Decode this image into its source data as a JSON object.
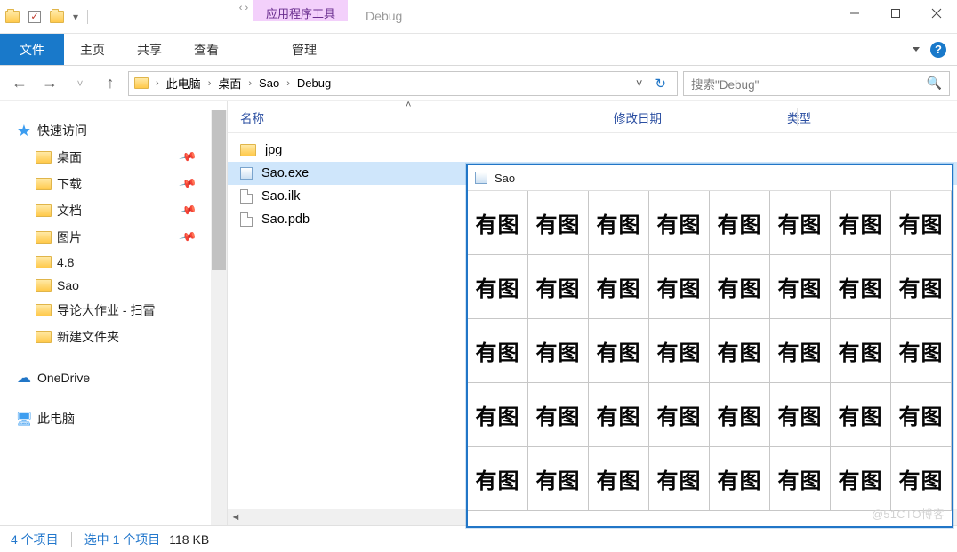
{
  "titlebar": {
    "tool_tab": "应用程序工具",
    "title": "Debug"
  },
  "ribbon": {
    "file": "文件",
    "tabs": [
      "主页",
      "共享",
      "查看"
    ],
    "tool_tab": "管理"
  },
  "address": {
    "segments": [
      "此电脑",
      "桌面",
      "Sao",
      "Debug"
    ]
  },
  "search": {
    "placeholder": "搜索\"Debug\""
  },
  "nav": {
    "quick_access": "快速访问",
    "items": [
      {
        "label": "桌面",
        "pinned": true,
        "icon": "folder"
      },
      {
        "label": "下载",
        "pinned": true,
        "icon": "folder"
      },
      {
        "label": "文档",
        "pinned": true,
        "icon": "folder"
      },
      {
        "label": "图片",
        "pinned": true,
        "icon": "folder"
      },
      {
        "label": "4.8",
        "pinned": false,
        "icon": "folder"
      },
      {
        "label": "Sao",
        "pinned": false,
        "icon": "folder"
      },
      {
        "label": "导论大作业 - 扫雷",
        "pinned": false,
        "icon": "folder"
      },
      {
        "label": "新建文件夹",
        "pinned": false,
        "icon": "folder"
      }
    ],
    "onedrive": "OneDrive",
    "this_pc": "此电脑"
  },
  "columns": {
    "name": "名称",
    "date": "修改日期",
    "type": "类型"
  },
  "files": [
    {
      "name": "jpg",
      "type": "folder",
      "selected": false
    },
    {
      "name": "Sao.exe",
      "type": "exe",
      "selected": true
    },
    {
      "name": "Sao.ilk",
      "type": "doc",
      "selected": false
    },
    {
      "name": "Sao.pdb",
      "type": "doc",
      "selected": false
    }
  ],
  "status": {
    "count": "4 个项目",
    "selection": "选中 1 个项目",
    "size": "118 KB"
  },
  "sao_window": {
    "title": "Sao",
    "cell_text": "有图",
    "rows": 5,
    "cols": 8
  },
  "watermark": "@51CTO博客"
}
